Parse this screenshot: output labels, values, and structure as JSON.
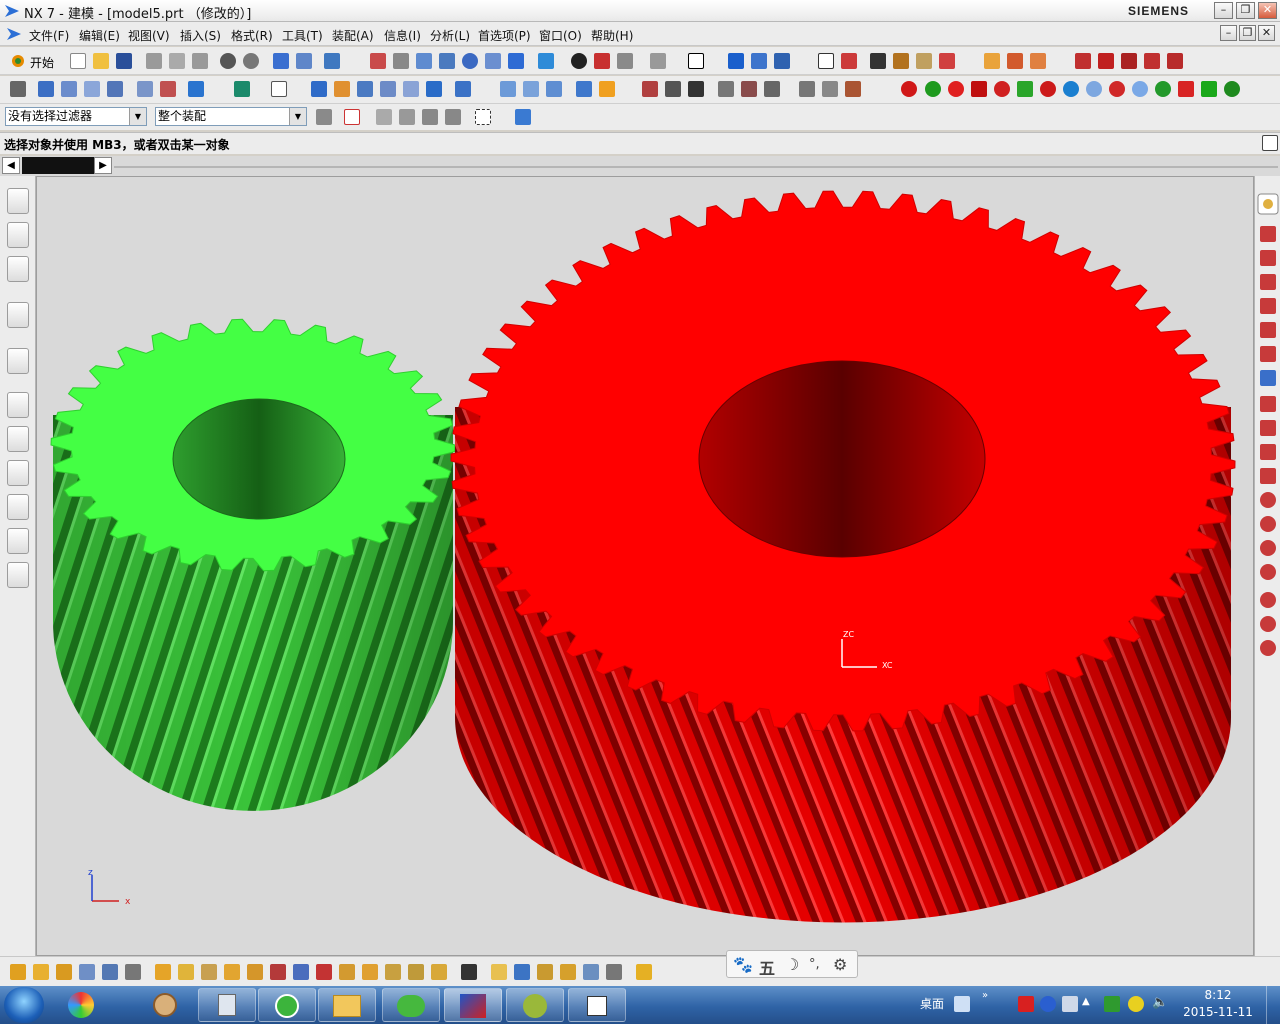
{
  "window": {
    "title": "NX 7 - 建模 - [model5.prt （修改的）]",
    "brand": "SIEMENS"
  },
  "menu": [
    "文件(F)",
    "编辑(E)",
    "视图(V)",
    "插入(S)",
    "格式(R)",
    "工具(T)",
    "装配(A)",
    "信息(I)",
    "分析(L)",
    "首选项(P)",
    "窗口(O)",
    "帮助(H)"
  ],
  "toolbar": {
    "start_label": "开始"
  },
  "selection": {
    "filter_value": "没有选择过滤器",
    "scope_value": "整个装配"
  },
  "cue_line": "选择对象并使用 MB3，或者双击某一对象",
  "axes": {
    "x": "x",
    "z": "z",
    "wcs_x": "XC",
    "wcs_z": "ZC"
  },
  "ime": {
    "char": "五"
  },
  "taskbar": {
    "desktop_label": "桌面",
    "time": "8:12",
    "date": "2015-11-11"
  },
  "colors": {
    "gear_small": "#44ff44",
    "gear_small_side": "#2ba82b",
    "gear_large": "#ff0000",
    "gear_large_side": "#b00000",
    "viewport_bg": "#d9d9d9"
  }
}
